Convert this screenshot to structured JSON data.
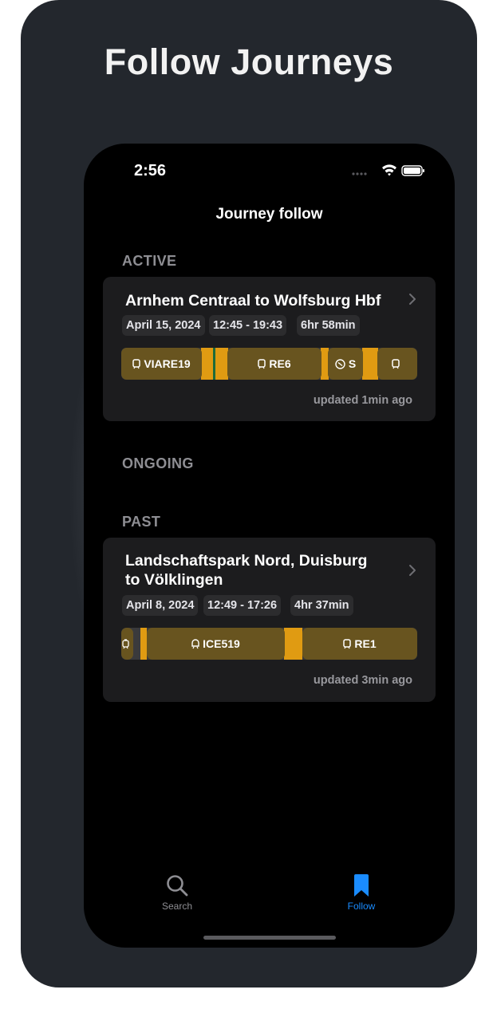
{
  "promo": {
    "headline": "Follow Journeys"
  },
  "status_bar": {
    "time": "2:56"
  },
  "nav": {
    "title": "Journey follow"
  },
  "sections": {
    "active": "ACTIVE",
    "ongoing": "ONGOING",
    "past": "PAST"
  },
  "active_journeys": [
    {
      "title": "Arnhem Centraal to Wolfsburg Hbf",
      "date": "April 15, 2024",
      "time_range": "12:45 - 19:43",
      "duration": "6hr 58min",
      "legs": [
        {
          "label": "VIARE19",
          "icon": "train-icon"
        },
        {
          "label": "RE6",
          "icon": "train-icon"
        },
        {
          "label": "S",
          "icon": "sbahn-icon"
        },
        {
          "label": "",
          "icon": "train-icon"
        }
      ],
      "updated": "updated 1min ago"
    }
  ],
  "past_journeys": [
    {
      "title_line1": "Landschaftspark Nord, Duisburg",
      "title_line2": "to Völklingen",
      "date": "April 8, 2024",
      "time_range": "12:49 - 17:26",
      "duration": "4hr 37min",
      "legs": [
        {
          "label": "",
          "icon": "tram-icon"
        },
        {
          "label": "ICE519",
          "icon": "highspeed-train-icon"
        },
        {
          "label": "RE1",
          "icon": "train-icon"
        }
      ],
      "updated": "updated 3min ago"
    }
  ],
  "tab_bar": {
    "items": [
      {
        "label": "Search",
        "icon": "search-icon",
        "selected": false
      },
      {
        "label": "Follow",
        "icon": "bookmark-icon",
        "selected": true
      }
    ]
  },
  "colors": {
    "accent": "#1a8cff",
    "timeline_gap": "#e09b12",
    "timeline_segment": "#68541f",
    "card_background": "#1c1c1e"
  }
}
